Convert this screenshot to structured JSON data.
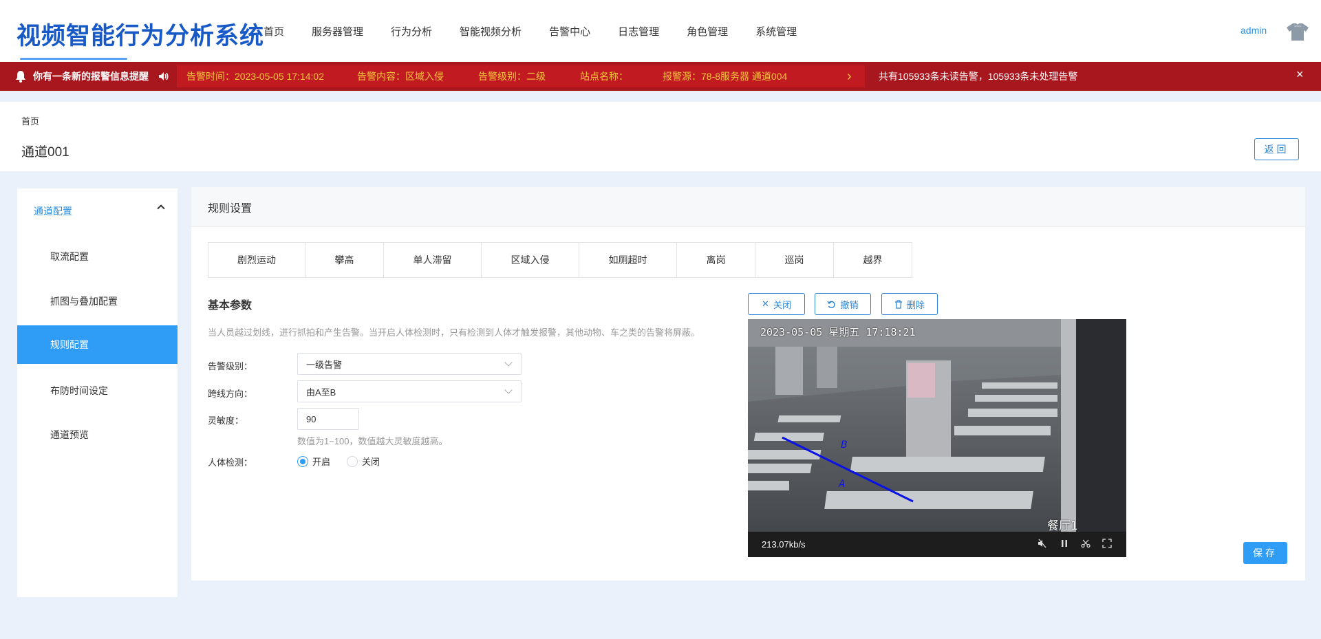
{
  "header": {
    "app_title": "视频智能行为分析系统",
    "nav": [
      "首页",
      "服务器管理",
      "行为分析",
      "智能视频分析",
      "告警中心",
      "日志管理",
      "角色管理",
      "系统管理"
    ],
    "user": "admin"
  },
  "alarm_bar": {
    "notice": "你有一条新的报警信息提醒",
    "time": "告警时间：2023-05-05 17:14:02",
    "content": "告警内容：区域入侵",
    "level": "告警级别：二级",
    "station": "站点名称：",
    "source": "报警源：78-8服务器 通道004",
    "summary": "共有105933条未读告警，105933条未处理告警",
    "next": "›",
    "close": "×"
  },
  "page": {
    "breadcrumb": "首页",
    "title": "通道001",
    "back_label": "返回"
  },
  "sidebar": {
    "group_label": "通道配置",
    "items": [
      "取流配置",
      "抓图与叠加配置",
      "规则配置",
      "布防时间设定",
      "通道预览"
    ],
    "active_index": 2
  },
  "panel": {
    "title": "规则设置",
    "tabs": [
      "剧烈运动",
      "攀高",
      "单人滞留",
      "区域入侵",
      "如厕超时",
      "离岗",
      "巡岗",
      "越界"
    ],
    "active_tab": 7,
    "section_title": "基本参数",
    "description": "当人员越过划线，进行抓拍和产生告警。当开启人体检测时，只有检测到人体才触发报警，其他动物、车之类的告警将屏蔽。",
    "form": {
      "alarm_level_label": "告警级别：",
      "alarm_level_value": "一级告警",
      "direction_label": "跨线方向：",
      "direction_value": "由A至B",
      "sensitivity_label": "灵敏度：",
      "sensitivity_value": "90",
      "sensitivity_hint": "数值为1~100，数值越大灵敏度越高。",
      "human_detect_label": "人体检测：",
      "human_detect_on": "开启",
      "human_detect_off": "关闭",
      "human_detect_selected": "开启"
    },
    "tools": {
      "close": "关闭",
      "undo": "撤销",
      "delete": "删除"
    },
    "video": {
      "osd_time": "2023-05-05 星期五 17:18:21",
      "osd_name": "餐厅1",
      "bitrate": "213.07kb/s",
      "label_a": "A",
      "label_b": "B"
    },
    "save_label": "保存"
  },
  "colors": {
    "brand": "#1659c7",
    "accent": "#2f9cf5",
    "alarm_bg": "#a8161e",
    "alarm_text": "#f5c63b",
    "rule_line": "#0a12e6"
  }
}
